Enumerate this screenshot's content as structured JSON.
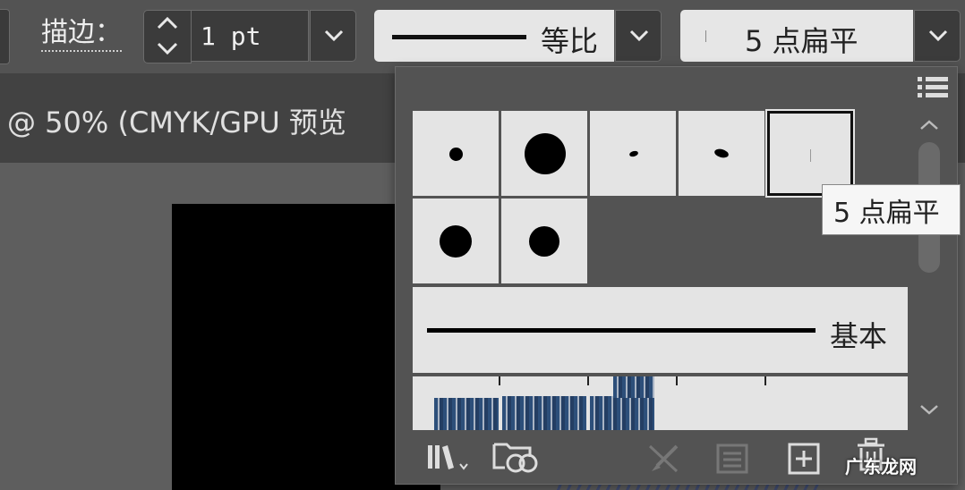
{
  "toolbar": {
    "stroke_label": "描边：",
    "weight_value": "1 pt",
    "profile_label": "等比",
    "brush_label": "5 点扁平"
  },
  "document": {
    "tab_title": "@ 50% (CMYK/GPU 预览"
  },
  "brush_panel": {
    "wide_brush_label": "基本",
    "tooltip": "5 点扁平",
    "icons": [
      "brush-libraries-icon",
      "cc-libraries-icon",
      "remove-stroke-icon",
      "brush-options-icon",
      "new-brush-icon",
      "delete-brush-icon",
      "panel-menu-icon"
    ]
  },
  "watermark": "广东龙网",
  "colors": {
    "ui_bg": "#535353",
    "field_bg": "#3b3b3b",
    "swatch_bg": "#e4e4e4"
  }
}
